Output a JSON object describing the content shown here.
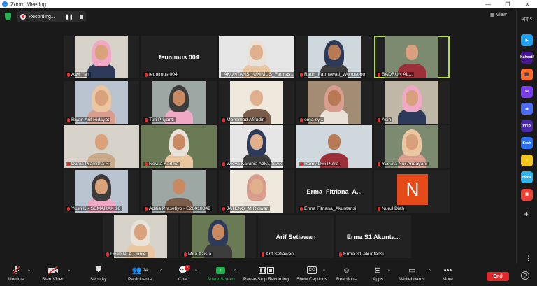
{
  "window": {
    "title": "Zoom Meeting",
    "min": "—",
    "restore": "❐",
    "close": "✕"
  },
  "recording": {
    "label": "Recording...",
    "pause": "❚❚"
  },
  "view": {
    "label": "▦ View"
  },
  "apps": {
    "label": "Apps",
    "icons": [
      {
        "name": "Apps1",
        "text": "▶",
        "color": "#1da1f2"
      },
      {
        "name": "Kahoot",
        "text": "Kahoot!",
        "color": "#46178f"
      },
      {
        "name": "Toolkit",
        "text": "⬛",
        "color": "#ff6a2b"
      },
      {
        "name": "Wooclap",
        "text": "W",
        "color": "#7a3ef0"
      },
      {
        "name": "Camera",
        "text": "◉",
        "color": "#4a6cf7"
      },
      {
        "name": "Prezi",
        "text": "Prezi",
        "color": "#4b2aa8"
      },
      {
        "name": "Sesh",
        "text": "Sesh",
        "color": "#2a6ff0"
      },
      {
        "name": "Emoji",
        "text": "☺",
        "color": "#f5c518"
      },
      {
        "name": "Twine",
        "text": "twine",
        "color": "#2fb4f2"
      },
      {
        "name": "Google",
        "text": "▦",
        "color": "#ea4335"
      }
    ],
    "add": "+",
    "more": "⋮",
    "help": "?"
  },
  "participants": [
    {
      "name": "Alwi Yah"
    },
    {
      "name": "feunimus 004",
      "big": "feunimus 004"
    },
    {
      "name": "AKUNTANSI_UNIMUS_Fatmas..."
    },
    {
      "name": "Ratih_Fatmawati_Wonosobo"
    },
    {
      "name": "BADRUN AL..."
    },
    {
      "name": "Riyan Arif Hidayat"
    },
    {
      "name": "Tuti Priyanti"
    },
    {
      "name": "Mohamad Afifudin"
    },
    {
      "name": "erna sy..."
    },
    {
      "name": "Asih"
    },
    {
      "name": "Dania Pramitha R"
    },
    {
      "name": "Novita Kartika"
    },
    {
      "name": "Widya Karunia Azka, S.Ak"
    },
    {
      "name": "Romy Dwi Putra"
    },
    {
      "name": "Yusvita Nur Andayani"
    },
    {
      "name": "Yusri K - SEMARAK 18"
    },
    {
      "name": "Aditia Prasetiyo - E28018049"
    },
    {
      "name": "JATENG_M Ridwan"
    },
    {
      "name": "Erma Fitriana_Akuntansi",
      "big": "Erma_Fitriana_A..."
    },
    {
      "name": "Nurul Diah",
      "initial": "N"
    },
    {
      "name": "Dyah N. A. Janie"
    },
    {
      "name": "Mira Azista"
    },
    {
      "name": "Arif Setiawan",
      "big": "Arif Setiawan"
    },
    {
      "name": "Erma S1 Akuntansi",
      "big": "Erma S1 Akunta..."
    }
  ],
  "toolbar": {
    "unmute": "Unmute",
    "start_video": "Start Video",
    "security": "Security",
    "participants": "Participants",
    "participants_count": "24",
    "chat": "Chat",
    "chat_badge": "7",
    "share_screen": "Share Screen",
    "pause_rec": "Pause/Stop Recording",
    "captions": "Show Captions",
    "captions_icon": "CC",
    "reactions": "Reactions",
    "apps": "Apps",
    "whiteboards": "Whiteboards",
    "more": "More",
    "end": "End"
  },
  "colors": {
    "accent": "#b4e03a",
    "end": "#e02828",
    "share": "#23b14d"
  }
}
